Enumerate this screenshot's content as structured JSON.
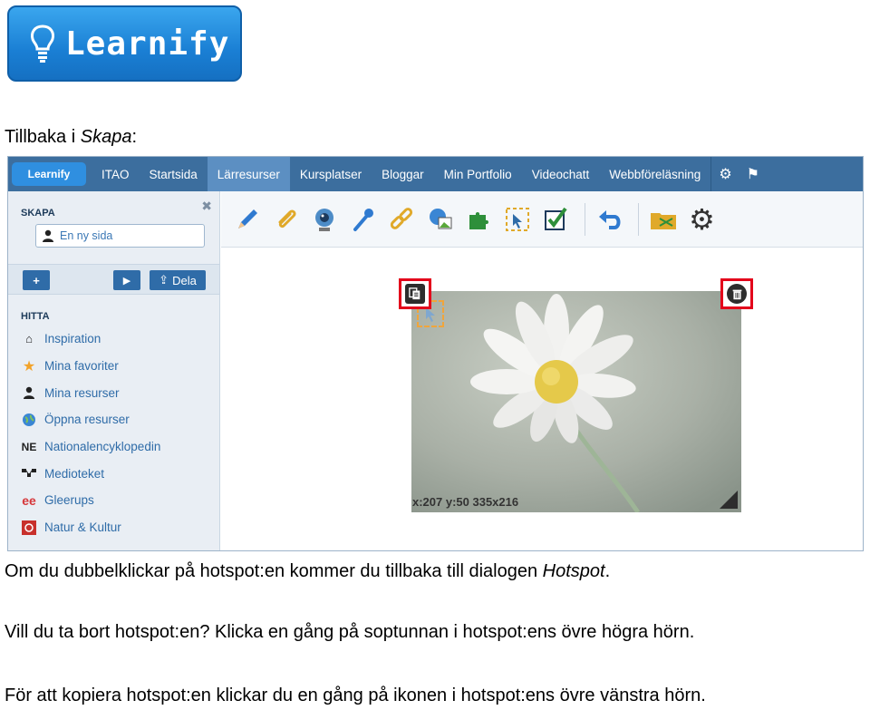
{
  "logo": {
    "text": "Learnify"
  },
  "doc": {
    "back_label": "Tillbaka i ",
    "back_label_em": "Skapa",
    "back_label_end": ":",
    "p1": "Om du dubbelklickar på hotspot:en kommer du tillbaka till dialogen ",
    "p1_em": "Hotspot",
    "p1_end": ".",
    "p2": "Vill du ta bort hotspot:en? Klicka en gång på soptunnan i hotspot:ens övre högra hörn.",
    "p3": "För att kopiera hotspot:en klickar du en gång på ikonen i hotspot:ens övre vänstra hörn."
  },
  "navbar": {
    "logo": "Learnify",
    "items": [
      "ITAO",
      "Startsida",
      "Lärresurser",
      "Kursplatser",
      "Bloggar",
      "Min Portfolio",
      "Videochatt",
      "Webbföreläsning"
    ],
    "active_index": 2,
    "icons": [
      "gear-icon",
      "flag-icon"
    ]
  },
  "sidebar": {
    "skapa_heading": "SKAPA",
    "new_page_label": "En ny sida",
    "add_label": "+",
    "play_label": "▶",
    "share_label": "Dela",
    "hitta_heading": "HITTA",
    "items": [
      {
        "label": "Inspiration",
        "icon": "home-icon"
      },
      {
        "label": "Mina favoriter",
        "icon": "star-icon"
      },
      {
        "label": "Mina resurser",
        "icon": "person-icon"
      },
      {
        "label": "Öppna resurser",
        "icon": "globe-icon"
      },
      {
        "label": "Nationalencyklopedin",
        "icon": "ne-icon"
      },
      {
        "label": "Medioteket",
        "icon": "network-icon"
      },
      {
        "label": "Gleerups",
        "icon": "ee-icon"
      },
      {
        "label": "Natur & Kultur",
        "icon": "nk-icon"
      }
    ]
  },
  "toolbar": {
    "icons": [
      "pencil-icon",
      "paperclip-icon",
      "webcam-icon",
      "microphone-icon",
      "link-icon",
      "image-icon",
      "puzzle-icon",
      "hotspot-icon",
      "checkbox-icon",
      "undo-icon",
      "folder-icon",
      "settings-icon"
    ]
  },
  "canvas": {
    "coords": "x:207 y:50 335x216"
  },
  "colors": {
    "navbar": "#3c6e9e",
    "accent": "#2f6ca8",
    "highlight": "#e3001b"
  }
}
